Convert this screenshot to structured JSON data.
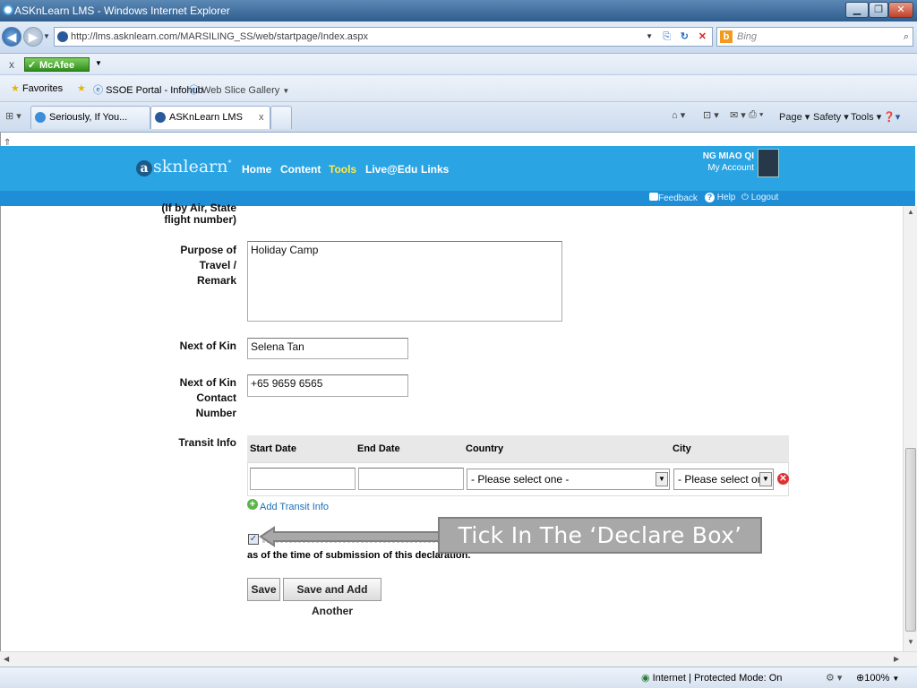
{
  "window": {
    "title": "ASKnLearn LMS - Windows Internet Explorer"
  },
  "address": {
    "url": "http://lms.asknlearn.com/MARSILING_SS/web/startpage/Index.aspx",
    "search_placeholder": "Bing"
  },
  "toolbar": {
    "mcafee": "McAfee"
  },
  "favorites": {
    "favorites_label": "Favorites",
    "items": [
      "SSOE Portal - Infohub",
      "Web Slice Gallery"
    ]
  },
  "tabs": {
    "items": [
      "Seriously, If You...",
      "ASKnLearn LMS"
    ]
  },
  "commands": {
    "page": "Page",
    "safety": "Safety",
    "tools": "Tools"
  },
  "lms": {
    "logo": "sknlearn",
    "nav": [
      "Home",
      "Content",
      "Tools",
      "Live@Edu",
      "Links"
    ],
    "user_name": "NG MIAO QI",
    "my_account": "My Account",
    "feedback": "Feedback",
    "help": "Help",
    "logout": "Logout"
  },
  "form": {
    "flight_label": "(If by Air, State\nflight number)",
    "purpose_label": "Purpose of\nTravel /\nRemark",
    "purpose_value": "Holiday Camp",
    "kin_label": "Next of Kin",
    "kin_value": "Selena Tan",
    "kin_contact_label": "Next of Kin\nContact\nNumber",
    "kin_contact_value": "+65 9659 6565",
    "transit_label": "Transit Info",
    "transit_headers": [
      "Start Date",
      "End Date",
      "Country",
      "City"
    ],
    "country_select": "- Please select one -",
    "city_select": "- Please select one -",
    "add_transit": "Add Transit Info",
    "declare_text_line2": "as of the time of submission of this declaration.",
    "save_label": "Save",
    "save_add_label": "Save and Add Another"
  },
  "callout": {
    "text": "Tick In The ‘Declare Box’"
  },
  "status": {
    "zone": "Internet | Protected Mode: On",
    "zoom": "100%"
  }
}
